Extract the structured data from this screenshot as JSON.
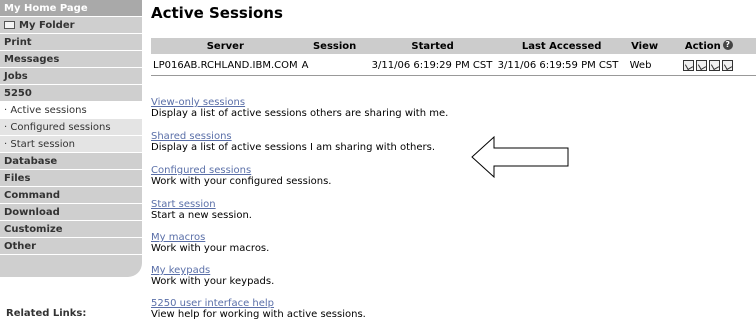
{
  "sidebar": {
    "items": [
      {
        "label": "My Home Page"
      },
      {
        "label": "My Folder"
      },
      {
        "label": "Print"
      },
      {
        "label": "Messages"
      },
      {
        "label": "Jobs"
      },
      {
        "label": "5250"
      },
      {
        "label": "· Active sessions"
      },
      {
        "label": "· Configured sessions"
      },
      {
        "label": "· Start session"
      },
      {
        "label": "Database"
      },
      {
        "label": "Files"
      },
      {
        "label": "Command"
      },
      {
        "label": "Download"
      },
      {
        "label": "Customize"
      },
      {
        "label": "Other"
      }
    ],
    "related_links": "Related Links:"
  },
  "main": {
    "title": "Active Sessions",
    "table": {
      "headers": [
        "Server",
        "Session",
        "Started",
        "Last Accessed",
        "View",
        "Action"
      ],
      "rows": [
        {
          "server": "LP016AB.RCHLAND.IBM.COM",
          "session": "A",
          "started": "3/11/06 6:19:29 PM CST",
          "last_accessed": "3/11/06 6:19:59 PM CST",
          "view": "Web"
        }
      ]
    },
    "links": [
      {
        "label": "View-only sessions",
        "desc": "Display a list of active sessions others are sharing with me."
      },
      {
        "label": "Shared sessions",
        "desc": "Display a list of active sessions I am sharing with others."
      },
      {
        "label": "Configured sessions",
        "desc": "Work with your configured sessions."
      },
      {
        "label": "Start session",
        "desc": "Start a new session."
      },
      {
        "label": "My macros",
        "desc": "Work with your macros."
      },
      {
        "label": "My keypads",
        "desc": "Work with your keypads."
      },
      {
        "label": "5250 user interface help",
        "desc": "View help for working with active sessions."
      }
    ]
  },
  "colors": {
    "sidebar_bg": "#cfcfcf",
    "sidebar_dark": "#a9a9a9",
    "table_header": "#cccccc",
    "link": "#5a6fa8"
  }
}
